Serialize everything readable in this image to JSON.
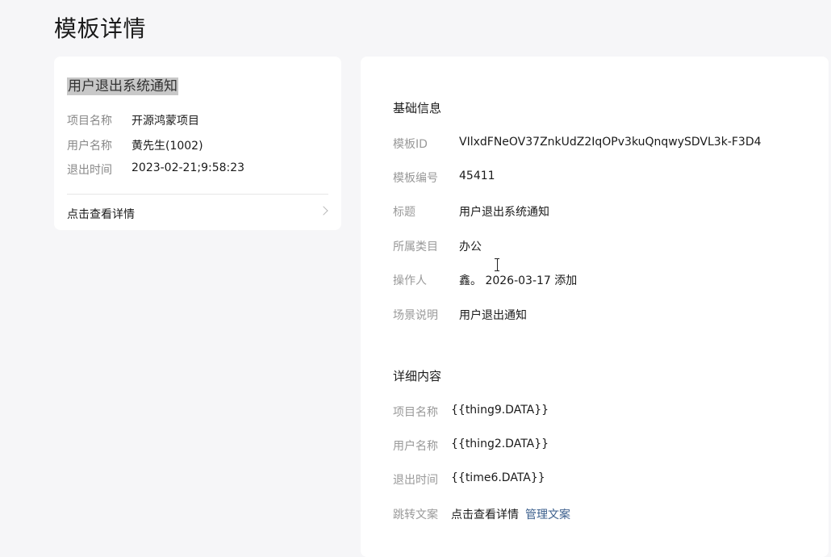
{
  "page": {
    "title": "模板详情"
  },
  "preview": {
    "title": "用户退出系统通知",
    "rows": [
      {
        "label": "项目名称",
        "value": "开源鸿蒙项目"
      },
      {
        "label": "用户名称",
        "value": "黄先生(1002)"
      },
      {
        "label": "退出时间",
        "value": "2023-02-21;9:58:23"
      }
    ],
    "link_label": "点击查看详情"
  },
  "basic_info": {
    "heading": "基础信息",
    "rows": [
      {
        "label": "模板ID",
        "value": "VIlxdFNeOV37ZnkUdZ2IqOPv3kuQnqwySDVL3k-F3D4"
      },
      {
        "label": "模板编号",
        "value": "45411"
      },
      {
        "label": "标题",
        "value": "用户退出系统通知"
      },
      {
        "label": "所属类目",
        "value": "办公"
      },
      {
        "label": "操作人",
        "value": "鑫。 2026-03-17 添加"
      },
      {
        "label": "场景说明",
        "value": "用户退出通知"
      }
    ]
  },
  "detail_content": {
    "heading": "详细内容",
    "rows": [
      {
        "label": "项目名称",
        "value": "{{thing9.DATA}}"
      },
      {
        "label": "用户名称",
        "value": "{{thing2.DATA}}"
      },
      {
        "label": "退出时间",
        "value": "{{time6.DATA}}"
      },
      {
        "label": "跳转文案",
        "value": "点击查看详情",
        "link": "管理文案"
      }
    ]
  },
  "colors": {
    "background": "#f6f6f8",
    "card": "#ffffff",
    "link": "#3a5e8c",
    "label": "#999999"
  }
}
